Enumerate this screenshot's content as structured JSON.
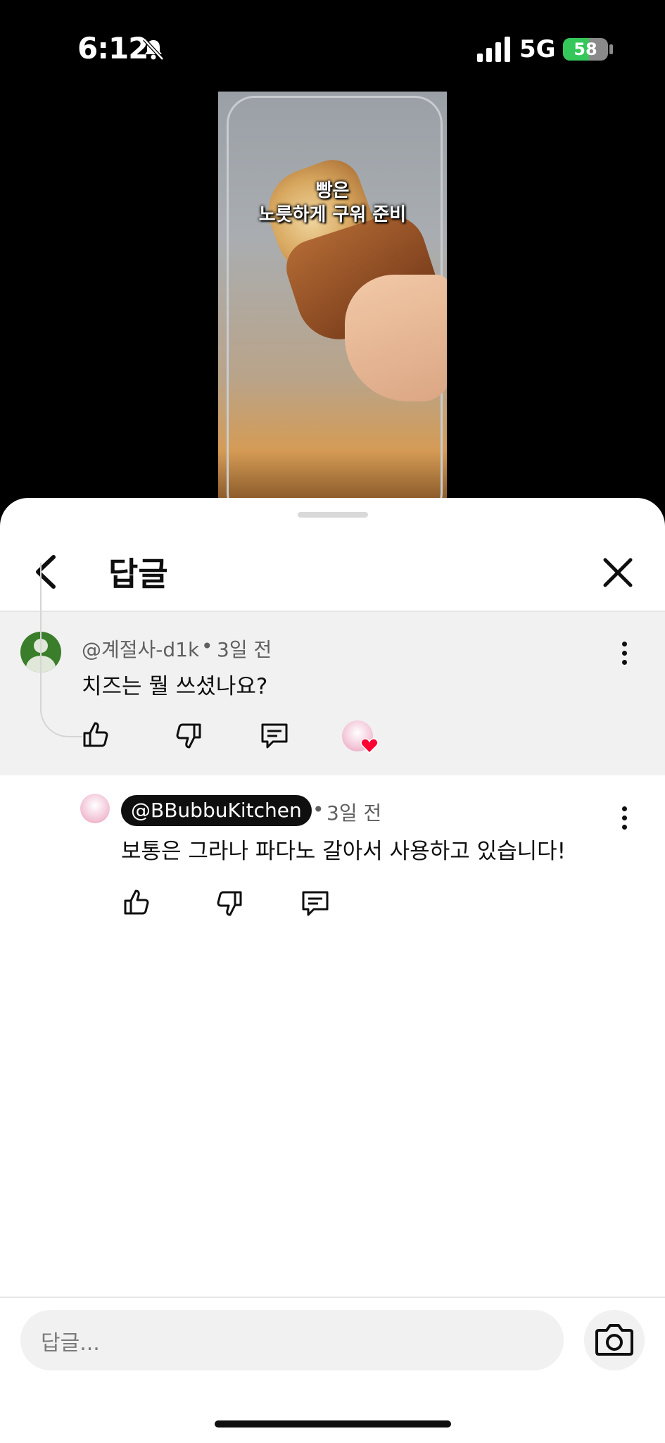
{
  "status_bar": {
    "time": "6:12",
    "network": "5G",
    "battery": "58",
    "battery_level": 0.58
  },
  "video": {
    "caption_line1": "빵은",
    "caption_line2": "노릇하게 구워 준비"
  },
  "sheet": {
    "title": "답글"
  },
  "parent_comment": {
    "author": "@계절사-d1k",
    "time": "3일 전",
    "text": "치즈는 뭘 쓰셨나요?"
  },
  "reply_comment": {
    "author": "@BBubbuKitchen",
    "time": "3일 전",
    "text": "보통은 그라나 파다노 갈아서 사용하고 있습니다!"
  },
  "composer": {
    "placeholder": "답글..."
  },
  "colors": {
    "accent_green": "#34c759",
    "heart_red": "#ff0033",
    "surface": "#f1f1f1"
  },
  "icons": [
    "bell-slash-icon",
    "signal-icon",
    "battery-icon",
    "back-icon",
    "close-icon",
    "more-icon",
    "like-icon",
    "dislike-icon",
    "reply-icon",
    "camera-icon",
    "heart-icon"
  ]
}
